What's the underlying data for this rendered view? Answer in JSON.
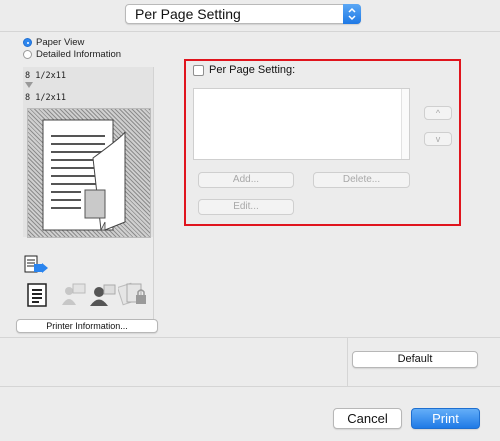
{
  "top_select": {
    "value": "Per Page Setting"
  },
  "left_panel": {
    "view_options": [
      {
        "label": "Paper View",
        "selected": true
      },
      {
        "label": "Detailed Information",
        "selected": false
      }
    ],
    "paper_size_original": "8 1/2x11",
    "paper_size_output": "8 1/2x11",
    "printer_info_label": "Printer Information..."
  },
  "per_page": {
    "checkbox_label": "Per Page Setting:",
    "checked": false,
    "add_label": "Add...",
    "delete_label": "Delete...",
    "edit_label": "Edit...",
    "up_label": "^",
    "down_label": "v"
  },
  "default_label": "Default",
  "cancel_label": "Cancel",
  "print_label": "Print",
  "colors": {
    "accent": "#2a84ee",
    "highlight": "#e0141d"
  }
}
